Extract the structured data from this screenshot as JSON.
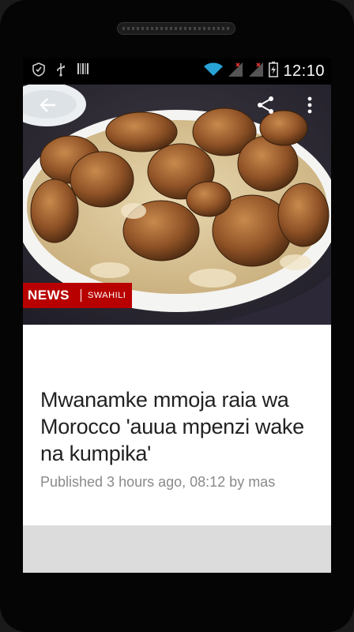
{
  "status_bar": {
    "time": "12:10",
    "icons": [
      "shield-notification-icon",
      "usb-icon",
      "barcode-icon",
      "wifi-icon",
      "signal-off-icon",
      "signal-off-icon",
      "battery-charging-icon"
    ]
  },
  "app_bar": {
    "back_icon": "arrow-back-icon",
    "share_icon": "share-icon",
    "menu_icon": "more-vert-icon"
  },
  "badge": {
    "brand": "NEWS",
    "section": "SWAHILI"
  },
  "article": {
    "headline": "Mwanamke mmoja raia wa Morocco 'auua mpenzi wake na kumpika'",
    "byline": "Published 3 hours ago, 08:12 by mas"
  },
  "colors": {
    "brand_red": "#b80000",
    "footer_gray": "#dcdcdc"
  }
}
